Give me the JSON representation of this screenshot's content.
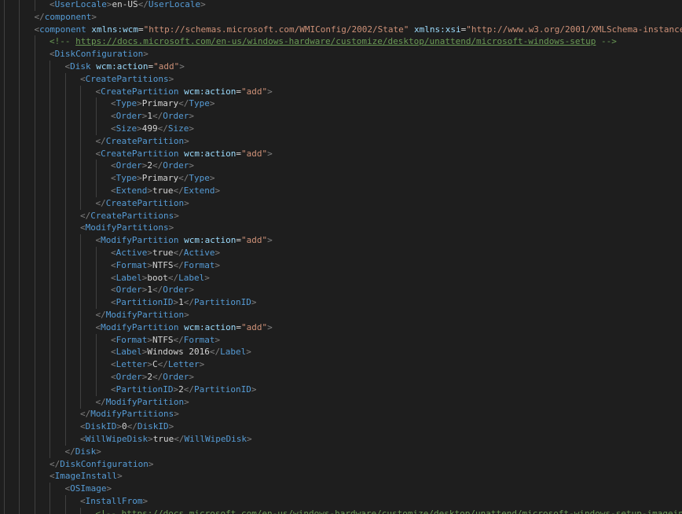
{
  "theme": {
    "background": "#1e1e1e",
    "tag": "#569cd6",
    "bracket": "#808080",
    "attribute": "#9cdcfe",
    "string": "#ce9178",
    "text": "#d4d4d4",
    "comment": "#6a9955",
    "guide": "#404040"
  },
  "lines": [
    {
      "indent": 3,
      "tokens": [
        [
          "b",
          "<"
        ],
        [
          "t",
          "UserLocale"
        ],
        [
          "b",
          ">"
        ],
        [
          "x",
          "en-US"
        ],
        [
          "b",
          "</"
        ],
        [
          "t",
          "UserLocale"
        ],
        [
          "b",
          ">"
        ]
      ]
    },
    {
      "indent": 2,
      "tokens": [
        [
          "b",
          "</"
        ],
        [
          "t",
          "component"
        ],
        [
          "b",
          ">"
        ]
      ]
    },
    {
      "indent": 2,
      "tokens": [
        [
          "b",
          "<"
        ],
        [
          "t",
          "component"
        ],
        [
          "x",
          " "
        ],
        [
          "a",
          "xmlns:wcm"
        ],
        [
          "eq",
          "="
        ],
        [
          "s",
          "\"http://schemas.microsoft.com/WMIConfig/2002/State\""
        ],
        [
          "x",
          " "
        ],
        [
          "a",
          "xmlns:xsi"
        ],
        [
          "eq",
          "="
        ],
        [
          "s",
          "\"http://www.w3.org/2001/XMLSchema-instance\""
        ],
        [
          "x",
          " "
        ],
        [
          "a",
          "na"
        ]
      ]
    },
    {
      "indent": 3,
      "tokens": [
        [
          "c",
          "<!-- "
        ],
        [
          "u",
          "https://docs.microsoft.com/en-us/windows-hardware/customize/desktop/unattend/microsoft-windows-setup"
        ],
        [
          "c",
          " -->"
        ]
      ]
    },
    {
      "indent": 3,
      "tokens": [
        [
          "b",
          "<"
        ],
        [
          "t",
          "DiskConfiguration"
        ],
        [
          "b",
          ">"
        ]
      ]
    },
    {
      "indent": 4,
      "tokens": [
        [
          "b",
          "<"
        ],
        [
          "t",
          "Disk"
        ],
        [
          "x",
          " "
        ],
        [
          "a",
          "wcm:action"
        ],
        [
          "eq",
          "="
        ],
        [
          "s",
          "\"add\""
        ],
        [
          "b",
          ">"
        ]
      ]
    },
    {
      "indent": 5,
      "tokens": [
        [
          "b",
          "<"
        ],
        [
          "t",
          "CreatePartitions"
        ],
        [
          "b",
          ">"
        ]
      ]
    },
    {
      "indent": 6,
      "tokens": [
        [
          "b",
          "<"
        ],
        [
          "t",
          "CreatePartition"
        ],
        [
          "x",
          " "
        ],
        [
          "a",
          "wcm:action"
        ],
        [
          "eq",
          "="
        ],
        [
          "s",
          "\"add\""
        ],
        [
          "b",
          ">"
        ]
      ]
    },
    {
      "indent": 7,
      "tokens": [
        [
          "b",
          "<"
        ],
        [
          "t",
          "Type"
        ],
        [
          "b",
          ">"
        ],
        [
          "x",
          "Primary"
        ],
        [
          "b",
          "</"
        ],
        [
          "t",
          "Type"
        ],
        [
          "b",
          ">"
        ]
      ]
    },
    {
      "indent": 7,
      "tokens": [
        [
          "b",
          "<"
        ],
        [
          "t",
          "Order"
        ],
        [
          "b",
          ">"
        ],
        [
          "x",
          "1"
        ],
        [
          "b",
          "</"
        ],
        [
          "t",
          "Order"
        ],
        [
          "b",
          ">"
        ]
      ]
    },
    {
      "indent": 7,
      "tokens": [
        [
          "b",
          "<"
        ],
        [
          "t",
          "Size"
        ],
        [
          "b",
          ">"
        ],
        [
          "x",
          "499"
        ],
        [
          "b",
          "</"
        ],
        [
          "t",
          "Size"
        ],
        [
          "b",
          ">"
        ]
      ]
    },
    {
      "indent": 6,
      "tokens": [
        [
          "b",
          "</"
        ],
        [
          "t",
          "CreatePartition"
        ],
        [
          "b",
          ">"
        ]
      ]
    },
    {
      "indent": 6,
      "tokens": [
        [
          "b",
          "<"
        ],
        [
          "t",
          "CreatePartition"
        ],
        [
          "x",
          " "
        ],
        [
          "a",
          "wcm:action"
        ],
        [
          "eq",
          "="
        ],
        [
          "s",
          "\"add\""
        ],
        [
          "b",
          ">"
        ]
      ]
    },
    {
      "indent": 7,
      "tokens": [
        [
          "b",
          "<"
        ],
        [
          "t",
          "Order"
        ],
        [
          "b",
          ">"
        ],
        [
          "x",
          "2"
        ],
        [
          "b",
          "</"
        ],
        [
          "t",
          "Order"
        ],
        [
          "b",
          ">"
        ]
      ]
    },
    {
      "indent": 7,
      "tokens": [
        [
          "b",
          "<"
        ],
        [
          "t",
          "Type"
        ],
        [
          "b",
          ">"
        ],
        [
          "x",
          "Primary"
        ],
        [
          "b",
          "</"
        ],
        [
          "t",
          "Type"
        ],
        [
          "b",
          ">"
        ]
      ]
    },
    {
      "indent": 7,
      "tokens": [
        [
          "b",
          "<"
        ],
        [
          "t",
          "Extend"
        ],
        [
          "b",
          ">"
        ],
        [
          "x",
          "true"
        ],
        [
          "b",
          "</"
        ],
        [
          "t",
          "Extend"
        ],
        [
          "b",
          ">"
        ]
      ]
    },
    {
      "indent": 6,
      "tokens": [
        [
          "b",
          "</"
        ],
        [
          "t",
          "CreatePartition"
        ],
        [
          "b",
          ">"
        ]
      ]
    },
    {
      "indent": 5,
      "tokens": [
        [
          "b",
          "</"
        ],
        [
          "t",
          "CreatePartitions"
        ],
        [
          "b",
          ">"
        ]
      ]
    },
    {
      "indent": 5,
      "tokens": [
        [
          "b",
          "<"
        ],
        [
          "t",
          "ModifyPartitions"
        ],
        [
          "b",
          ">"
        ]
      ]
    },
    {
      "indent": 6,
      "tokens": [
        [
          "b",
          "<"
        ],
        [
          "t",
          "ModifyPartition"
        ],
        [
          "x",
          " "
        ],
        [
          "a",
          "wcm:action"
        ],
        [
          "eq",
          "="
        ],
        [
          "s",
          "\"add\""
        ],
        [
          "b",
          ">"
        ]
      ]
    },
    {
      "indent": 7,
      "tokens": [
        [
          "b",
          "<"
        ],
        [
          "t",
          "Active"
        ],
        [
          "b",
          ">"
        ],
        [
          "x",
          "true"
        ],
        [
          "b",
          "</"
        ],
        [
          "t",
          "Active"
        ],
        [
          "b",
          ">"
        ]
      ]
    },
    {
      "indent": 7,
      "tokens": [
        [
          "b",
          "<"
        ],
        [
          "t",
          "Format"
        ],
        [
          "b",
          ">"
        ],
        [
          "x",
          "NTFS"
        ],
        [
          "b",
          "</"
        ],
        [
          "t",
          "Format"
        ],
        [
          "b",
          ">"
        ]
      ]
    },
    {
      "indent": 7,
      "tokens": [
        [
          "b",
          "<"
        ],
        [
          "t",
          "Label"
        ],
        [
          "b",
          ">"
        ],
        [
          "x",
          "boot"
        ],
        [
          "b",
          "</"
        ],
        [
          "t",
          "Label"
        ],
        [
          "b",
          ">"
        ]
      ]
    },
    {
      "indent": 7,
      "tokens": [
        [
          "b",
          "<"
        ],
        [
          "t",
          "Order"
        ],
        [
          "b",
          ">"
        ],
        [
          "x",
          "1"
        ],
        [
          "b",
          "</"
        ],
        [
          "t",
          "Order"
        ],
        [
          "b",
          ">"
        ]
      ]
    },
    {
      "indent": 7,
      "tokens": [
        [
          "b",
          "<"
        ],
        [
          "t",
          "PartitionID"
        ],
        [
          "b",
          ">"
        ],
        [
          "x",
          "1"
        ],
        [
          "b",
          "</"
        ],
        [
          "t",
          "PartitionID"
        ],
        [
          "b",
          ">"
        ]
      ]
    },
    {
      "indent": 6,
      "tokens": [
        [
          "b",
          "</"
        ],
        [
          "t",
          "ModifyPartition"
        ],
        [
          "b",
          ">"
        ]
      ]
    },
    {
      "indent": 6,
      "tokens": [
        [
          "b",
          "<"
        ],
        [
          "t",
          "ModifyPartition"
        ],
        [
          "x",
          " "
        ],
        [
          "a",
          "wcm:action"
        ],
        [
          "eq",
          "="
        ],
        [
          "s",
          "\"add\""
        ],
        [
          "b",
          ">"
        ]
      ]
    },
    {
      "indent": 7,
      "tokens": [
        [
          "b",
          "<"
        ],
        [
          "t",
          "Format"
        ],
        [
          "b",
          ">"
        ],
        [
          "x",
          "NTFS"
        ],
        [
          "b",
          "</"
        ],
        [
          "t",
          "Format"
        ],
        [
          "b",
          ">"
        ]
      ]
    },
    {
      "indent": 7,
      "tokens": [
        [
          "b",
          "<"
        ],
        [
          "t",
          "Label"
        ],
        [
          "b",
          ">"
        ],
        [
          "x",
          "Windows 2016"
        ],
        [
          "b",
          "</"
        ],
        [
          "t",
          "Label"
        ],
        [
          "b",
          ">"
        ]
      ]
    },
    {
      "indent": 7,
      "tokens": [
        [
          "b",
          "<"
        ],
        [
          "t",
          "Letter"
        ],
        [
          "b",
          ">"
        ],
        [
          "x",
          "C"
        ],
        [
          "b",
          "</"
        ],
        [
          "t",
          "Letter"
        ],
        [
          "b",
          ">"
        ]
      ]
    },
    {
      "indent": 7,
      "tokens": [
        [
          "b",
          "<"
        ],
        [
          "t",
          "Order"
        ],
        [
          "b",
          ">"
        ],
        [
          "x",
          "2"
        ],
        [
          "b",
          "</"
        ],
        [
          "t",
          "Order"
        ],
        [
          "b",
          ">"
        ]
      ]
    },
    {
      "indent": 7,
      "tokens": [
        [
          "b",
          "<"
        ],
        [
          "t",
          "PartitionID"
        ],
        [
          "b",
          ">"
        ],
        [
          "x",
          "2"
        ],
        [
          "b",
          "</"
        ],
        [
          "t",
          "PartitionID"
        ],
        [
          "b",
          ">"
        ]
      ]
    },
    {
      "indent": 6,
      "tokens": [
        [
          "b",
          "</"
        ],
        [
          "t",
          "ModifyPartition"
        ],
        [
          "b",
          ">"
        ]
      ]
    },
    {
      "indent": 5,
      "tokens": [
        [
          "b",
          "</"
        ],
        [
          "t",
          "ModifyPartitions"
        ],
        [
          "b",
          ">"
        ]
      ]
    },
    {
      "indent": 5,
      "tokens": [
        [
          "b",
          "<"
        ],
        [
          "t",
          "DiskID"
        ],
        [
          "b",
          ">"
        ],
        [
          "x",
          "0"
        ],
        [
          "b",
          "</"
        ],
        [
          "t",
          "DiskID"
        ],
        [
          "b",
          ">"
        ]
      ]
    },
    {
      "indent": 5,
      "tokens": [
        [
          "b",
          "<"
        ],
        [
          "t",
          "WillWipeDisk"
        ],
        [
          "b",
          ">"
        ],
        [
          "x",
          "true"
        ],
        [
          "b",
          "</"
        ],
        [
          "t",
          "WillWipeDisk"
        ],
        [
          "b",
          ">"
        ]
      ]
    },
    {
      "indent": 4,
      "tokens": [
        [
          "b",
          "</"
        ],
        [
          "t",
          "Disk"
        ],
        [
          "b",
          ">"
        ]
      ]
    },
    {
      "indent": 3,
      "tokens": [
        [
          "b",
          "</"
        ],
        [
          "t",
          "DiskConfiguration"
        ],
        [
          "b",
          ">"
        ]
      ]
    },
    {
      "indent": 3,
      "tokens": [
        [
          "b",
          "<"
        ],
        [
          "t",
          "ImageInstall"
        ],
        [
          "b",
          ">"
        ]
      ]
    },
    {
      "indent": 4,
      "tokens": [
        [
          "b",
          "<"
        ],
        [
          "t",
          "OSImage"
        ],
        [
          "b",
          ">"
        ]
      ]
    },
    {
      "indent": 5,
      "tokens": [
        [
          "b",
          "<"
        ],
        [
          "t",
          "InstallFrom"
        ],
        [
          "b",
          ">"
        ]
      ]
    },
    {
      "indent": 6,
      "tokens": [
        [
          "c",
          "<!-- "
        ],
        [
          "u",
          "https://docs.microsoft.com/en-us/windows-hardware/customize/desktop/unattend/microsoft-windows-setup-imageinstal"
        ]
      ]
    }
  ]
}
